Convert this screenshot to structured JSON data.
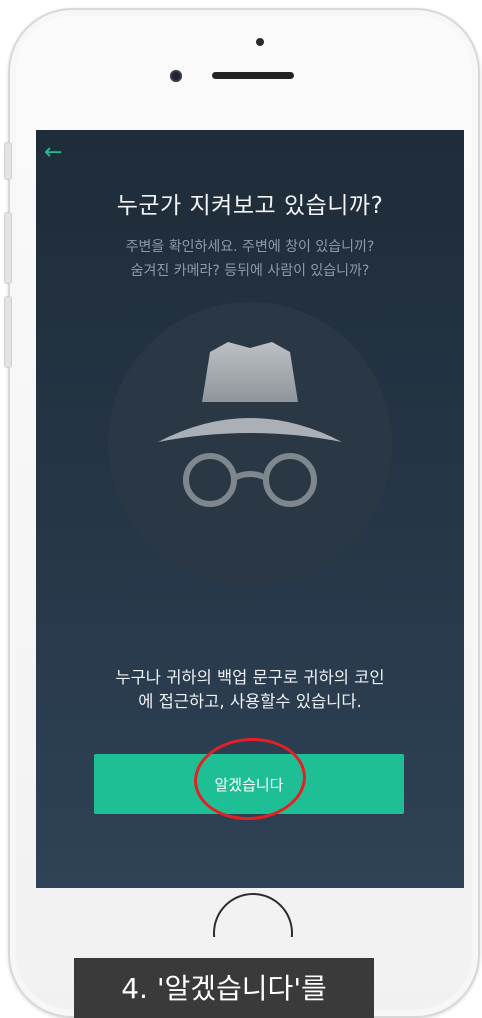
{
  "screen": {
    "back_icon": "←",
    "title": "누군가 지켜보고 있습니까?",
    "subtitle_line1": "주변을 확인하세요. 주변에 창이 있습니끼?",
    "subtitle_line2": "숨겨진 카메라? 등뒤에 사람이 있습니까?",
    "message_line1": "누구나 귀하의 백업 문구로 귀하의 코인",
    "message_line2": "에 접근하고, 사용할수 있습니다.",
    "cta_label": "알겠습니다",
    "accent_color": "#1fbf95",
    "icon": "incognito-icon"
  },
  "caption": {
    "text": "4. '알겠습니다'를"
  },
  "annotation": {
    "highlight_color": "#e32025"
  }
}
